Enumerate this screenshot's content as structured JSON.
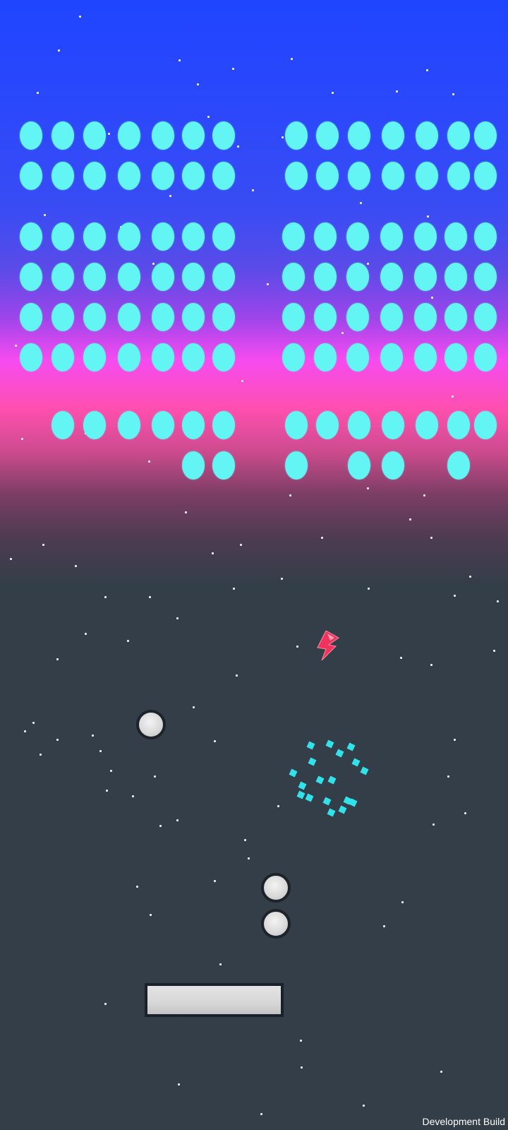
{
  "game": {
    "title": "",
    "state": "playing",
    "balls_in_play": 3,
    "powerup": {
      "type": "lightning-bolt-icon",
      "color": "#f0335c"
    }
  },
  "colors": {
    "brick": "#63f5f3",
    "ground": "#333e48",
    "ball": "#dadada",
    "paddle": "#d7d7d7",
    "particle": "#32e2ea"
  },
  "bricks": {
    "total_visible": 105
  },
  "overlay": {
    "build_label": "Development Build"
  }
}
